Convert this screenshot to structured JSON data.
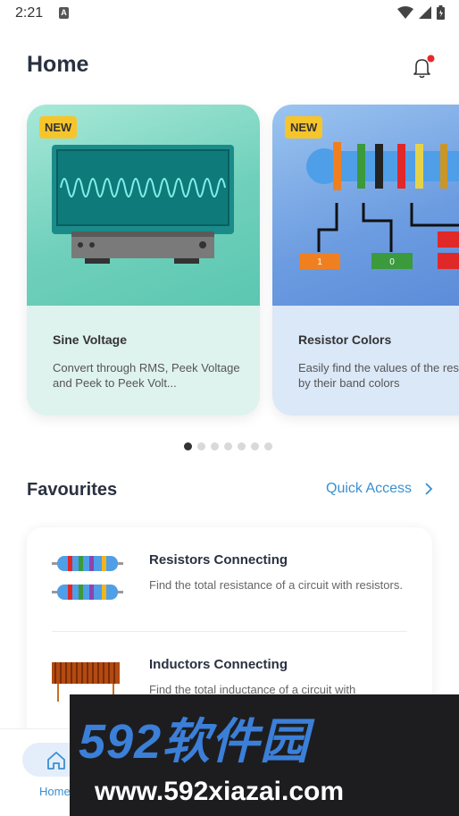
{
  "status_bar": {
    "time": "2:21",
    "notification_icon": "A"
  },
  "header": {
    "title": "Home"
  },
  "carousel": {
    "cards": [
      {
        "badge": "NEW",
        "title": "Sine Voltage",
        "description": "Convert through RMS, Peek Voltage and Peek to Peek Volt..."
      },
      {
        "badge": "NEW",
        "title": "Resistor Colors",
        "description": "Easily find the values of the resistors by their band colors",
        "band_values": [
          "1",
          "0"
        ]
      }
    ],
    "page_count": 7,
    "active_page": 1
  },
  "favourites": {
    "title": "Favourites",
    "quick_access": "Quick Access",
    "items": [
      {
        "name": "Resistors Connecting",
        "description": "Find the total resistance of a circuit with resistors."
      },
      {
        "name": "Inductors Connecting",
        "description": "Find the total inductance of a circuit with"
      }
    ]
  },
  "bottom_nav": {
    "home_label": "Home"
  },
  "watermark": {
    "text_cn": "592软件园",
    "url": "www.592xiazai.com"
  },
  "colors": {
    "accent": "#3a8fd0",
    "badge": "#f6c52c",
    "title": "#2a3140"
  }
}
